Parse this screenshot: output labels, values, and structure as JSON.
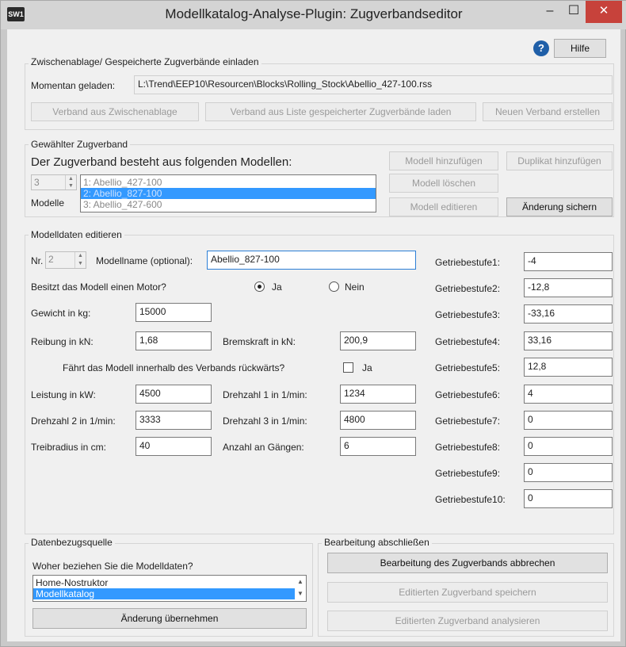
{
  "window": {
    "title": "Modellkatalog-Analyse-Plugin: Zugverbandseditor",
    "app_icon_text": "SW1",
    "minimize_glyph": "–",
    "maximize_glyph": "☐",
    "close_glyph": "✕"
  },
  "help": {
    "icon_glyph": "?",
    "button_label": "Hilfe"
  },
  "import_group": {
    "label": "Zwischenablage/ Gespeicherte Zugverbände einladen",
    "loaded_label": "Momentan geladen:",
    "loaded_path": "L:\\Trend\\EEP10\\Resourcen\\Blocks\\Rolling_Stock\\Abellio_427-100.rss",
    "btn_from_clipboard": "Verband aus Zwischenablage",
    "btn_from_list": "Verband aus Liste gespeicherter Zugverbände laden",
    "btn_new": "Neuen Verband erstellen"
  },
  "consist_group": {
    "label": "Gewählter Zugverband",
    "heading": "Der Zugverband besteht aus folgenden Modellen:",
    "count": "3",
    "count_label": "Modelle",
    "models": [
      {
        "label": "1: Abellio_427-100",
        "selected": false
      },
      {
        "label": "2: Abellio_827-100",
        "selected": true
      },
      {
        "label": "3: Abellio_427-600",
        "selected": false
      }
    ],
    "btn_add_model": "Modell hinzufügen",
    "btn_add_duplicate": "Duplikat hinzufügen",
    "btn_delete_model": "Modell löschen",
    "btn_edit_model": "Modell editieren",
    "btn_save_change": "Änderung sichern"
  },
  "model_group": {
    "label": "Modelldaten editieren",
    "nr_label": "Nr.",
    "nr_value": "2",
    "name_label": "Modellname (optional):",
    "name_value": "Abellio_827-100",
    "motor_question": "Besitzt das Modell einen Motor?",
    "motor_yes": "Ja",
    "motor_no": "Nein",
    "motor_selected": "Ja",
    "weight_label": "Gewicht in kg:",
    "weight_value": "15000",
    "friction_label": "Reibung in kN:",
    "friction_value": "1,68",
    "brake_label": "Bremskraft in kN:",
    "brake_value": "200,9",
    "reverse_question": "Fährt das Modell innerhalb des Verbands rückwärts?",
    "reverse_label": "Ja",
    "reverse_checked": false,
    "power_label": "Leistung in kW:",
    "power_value": "4500",
    "rpm1_label": "Drehzahl 1 in 1/min:",
    "rpm1_value": "1234",
    "rpm2_label": "Drehzahl 2 in 1/min:",
    "rpm2_value": "3333",
    "rpm3_label": "Drehzahl 3 in 1/min:",
    "rpm3_value": "4800",
    "radius_label": "Treibradius in cm:",
    "radius_value": "40",
    "gears_label": "Anzahl an Gängen:",
    "gears_value": "6",
    "gear_stages": [
      {
        "label": "Getriebestufe1:",
        "value": "-4"
      },
      {
        "label": "Getriebestufe2:",
        "value": "-12,8"
      },
      {
        "label": "Getriebestufe3:",
        "value": "-33,16"
      },
      {
        "label": "Getriebestufe4:",
        "value": "33,16"
      },
      {
        "label": "Getriebestufe5:",
        "value": "12,8"
      },
      {
        "label": "Getriebestufe6:",
        "value": "4"
      },
      {
        "label": "Getriebestufe7:",
        "value": "0"
      },
      {
        "label": "Getriebestufe8:",
        "value": "0"
      },
      {
        "label": "Getriebestufe9:",
        "value": "0"
      },
      {
        "label": "Getriebestufe10:",
        "value": "0"
      }
    ]
  },
  "source_group": {
    "label": "Datenbezugsquelle",
    "question": "Woher beziehen Sie die Modelldaten?",
    "options": [
      {
        "label": "Home-Nostruktor",
        "selected": false
      },
      {
        "label": "Modellkatalog",
        "selected": true
      }
    ],
    "btn_apply": "Änderung übernehmen"
  },
  "finish_group": {
    "label": "Bearbeitung abschließen",
    "btn_cancel": "Bearbeitung des Zugverbands abbrechen",
    "btn_save": "Editierten Zugverband speichern",
    "btn_analyze": "Editierten Zugverband analysieren"
  }
}
